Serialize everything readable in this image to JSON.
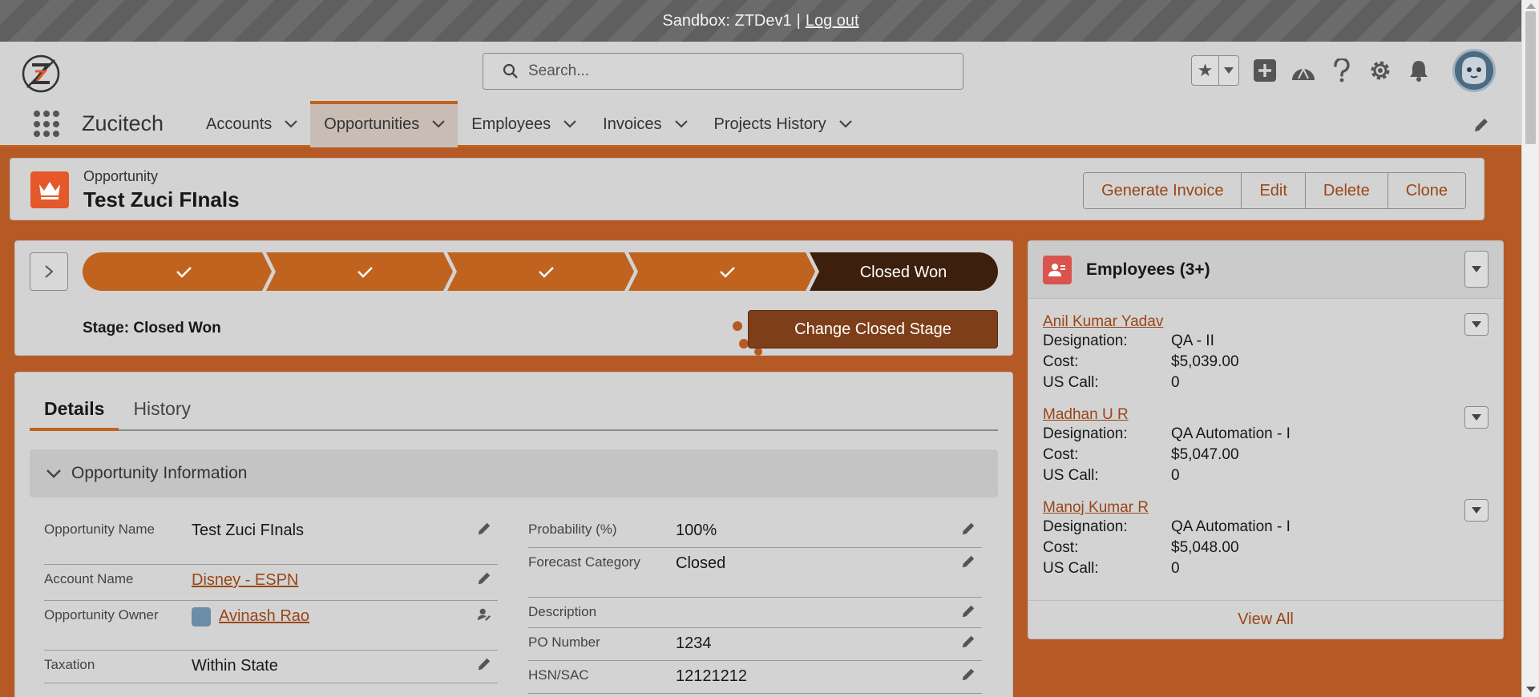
{
  "banner": {
    "sandbox_text": "Sandbox: ZTDev1",
    "separator": "|",
    "logout_label": "Log out"
  },
  "header": {
    "search_placeholder": "Search..."
  },
  "nav": {
    "app_name": "Zucitech",
    "items": [
      {
        "label": "Accounts"
      },
      {
        "label": "Opportunities",
        "active": true
      },
      {
        "label": "Employees"
      },
      {
        "label": "Invoices"
      },
      {
        "label": "Projects History"
      }
    ]
  },
  "record": {
    "type": "Opportunity",
    "title": "Test Zuci FInals",
    "actions": [
      "Generate Invoice",
      "Edit",
      "Delete",
      "Clone"
    ]
  },
  "path": {
    "completed_stage_count": 4,
    "current_stage": "Closed Won",
    "stage_info": "Stage: Closed Won",
    "change_button": "Change Closed Stage"
  },
  "tabs": [
    "Details",
    "History"
  ],
  "section": {
    "title": "Opportunity Information"
  },
  "fields_left": [
    {
      "label": "Opportunity Name",
      "value": "Test Zuci FInals"
    },
    {
      "label": "Account Name",
      "value": "Disney - ESPN",
      "link": true
    },
    {
      "label": "Opportunity Owner",
      "value": "Avinash Rao",
      "link": true
    },
    {
      "label": "Taxation",
      "value": "Within State"
    }
  ],
  "fields_right": [
    {
      "label": "Probability (%)",
      "value": "100%"
    },
    {
      "label": "Forecast Category",
      "value": "Closed"
    },
    {
      "label": "Description",
      "value": ""
    },
    {
      "label": "PO Number",
      "value": "1234"
    },
    {
      "label": "HSN/SAC",
      "value": "12121212"
    }
  ],
  "related": {
    "title": "Employees (3+)",
    "labels": {
      "designation": "Designation:",
      "cost": "Cost:",
      "us_call": "US Call:"
    },
    "employees": [
      {
        "name": "Anil Kumar Yadav",
        "designation": "QA - II",
        "cost": "$5,039.00",
        "us_call": "0"
      },
      {
        "name": "Madhan U R",
        "designation": "QA Automation - I",
        "cost": "$5,047.00",
        "us_call": "0"
      },
      {
        "name": "Manoj Kumar R",
        "designation": "QA Automation - I",
        "cost": "$5,048.00",
        "us_call": "0"
      }
    ],
    "view_all": "View All"
  },
  "colors": {
    "accent": "#c0631f",
    "link": "#9a4617",
    "record_icon": "#e4582a",
    "path_dark": "#3d1f0e"
  },
  "icons": [
    "logo-icon",
    "search-icon",
    "star-icon",
    "caret-down-icon",
    "add-icon",
    "trailhead-icon",
    "help-icon",
    "gear-icon",
    "bell-icon",
    "avatar-icon",
    "app-launcher-icon",
    "pencil-icon",
    "crown-icon",
    "chevron-right-icon",
    "check-icon",
    "contact-icon"
  ]
}
